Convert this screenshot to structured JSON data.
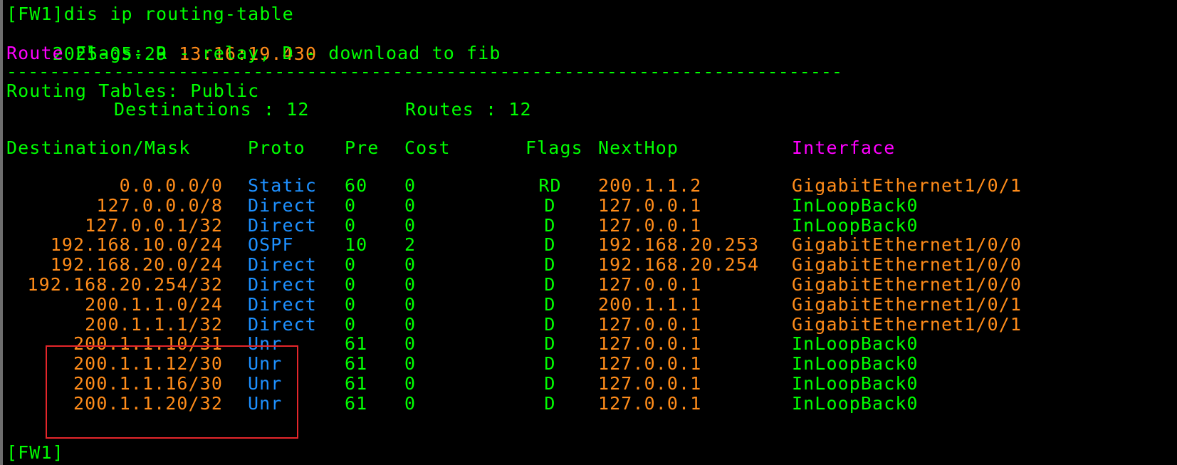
{
  "terminal": {
    "command_line": "[FW1]dis ip routing-table",
    "timestamp": {
      "date": "2025-05-29",
      "time": "13:16:19.430"
    },
    "flags_line": {
      "keyword": "Route",
      "rest": " Flags: R - relay, D - download to fib"
    },
    "separator": "------------------------------------------------------------------------------",
    "routing_tables_label": "Routing Tables: Public",
    "summary": {
      "destinations_label": "Destinations : 12",
      "routes_label": "Routes : 12"
    },
    "headers": {
      "destination": "Destination/Mask",
      "proto": "Proto",
      "pre": "Pre",
      "cost": "Cost",
      "flags": "Flags",
      "nexthop": "NextHop",
      "interface": "Interface"
    },
    "routes": [
      {
        "destination": "0.0.0.0/0",
        "proto": "Static",
        "pre": "60",
        "cost": "0",
        "flags": "RD",
        "nexthop": "200.1.1.2",
        "interface": "GigabitEthernet1/0/1"
      },
      {
        "destination": "127.0.0.0/8",
        "proto": "Direct",
        "pre": "0",
        "cost": "0",
        "flags": "D",
        "nexthop": "127.0.0.1",
        "interface": "InLoopBack0"
      },
      {
        "destination": "127.0.0.1/32",
        "proto": "Direct",
        "pre": "0",
        "cost": "0",
        "flags": "D",
        "nexthop": "127.0.0.1",
        "interface": "InLoopBack0"
      },
      {
        "destination": "192.168.10.0/24",
        "proto": "OSPF",
        "pre": "10",
        "cost": "2",
        "flags": "D",
        "nexthop": "192.168.20.253",
        "interface": "GigabitEthernet1/0/0"
      },
      {
        "destination": "192.168.20.0/24",
        "proto": "Direct",
        "pre": "0",
        "cost": "0",
        "flags": "D",
        "nexthop": "192.168.20.254",
        "interface": "GigabitEthernet1/0/0"
      },
      {
        "destination": "192.168.20.254/32",
        "proto": "Direct",
        "pre": "0",
        "cost": "0",
        "flags": "D",
        "nexthop": "127.0.0.1",
        "interface": "GigabitEthernet1/0/0"
      },
      {
        "destination": "200.1.1.0/24",
        "proto": "Direct",
        "pre": "0",
        "cost": "0",
        "flags": "D",
        "nexthop": "200.1.1.1",
        "interface": "GigabitEthernet1/0/1"
      },
      {
        "destination": "200.1.1.1/32",
        "proto": "Direct",
        "pre": "0",
        "cost": "0",
        "flags": "D",
        "nexthop": "127.0.0.1",
        "interface": "GigabitEthernet1/0/1"
      },
      {
        "destination": "200.1.1.10/31",
        "proto": "Unr",
        "pre": "61",
        "cost": "0",
        "flags": "D",
        "nexthop": "127.0.0.1",
        "interface": "InLoopBack0"
      },
      {
        "destination": "200.1.1.12/30",
        "proto": "Unr",
        "pre": "61",
        "cost": "0",
        "flags": "D",
        "nexthop": "127.0.0.1",
        "interface": "InLoopBack0"
      },
      {
        "destination": "200.1.1.16/30",
        "proto": "Unr",
        "pre": "61",
        "cost": "0",
        "flags": "D",
        "nexthop": "127.0.0.1",
        "interface": "InLoopBack0"
      },
      {
        "destination": "200.1.1.20/32",
        "proto": "Unr",
        "pre": "61",
        "cost": "0",
        "flags": "D",
        "nexthop": "127.0.0.1",
        "interface": "InLoopBack0"
      }
    ],
    "prompt": "[FW1]"
  },
  "colors": {
    "background": "#000000",
    "text_green": "#00ff00",
    "text_orange": "#ff8c1a",
    "text_blue": "#1e90ff",
    "text_magenta": "#ff00ff",
    "highlight_border": "#e5262b"
  }
}
